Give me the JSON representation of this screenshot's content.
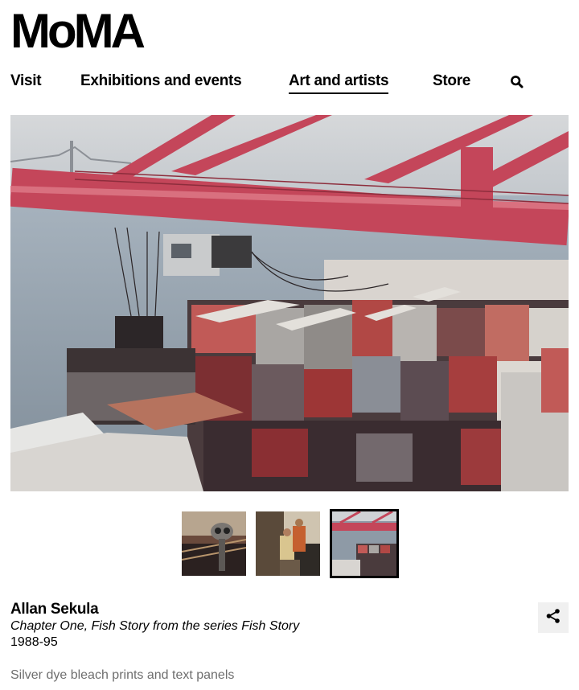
{
  "header": {
    "logo": "MoMA",
    "nav": [
      {
        "label": "Visit",
        "active": false
      },
      {
        "label": "Exhibitions and events",
        "active": false
      },
      {
        "label": "Art and artists",
        "active": true
      },
      {
        "label": "Store",
        "active": false
      }
    ],
    "search_icon": "search-icon"
  },
  "artwork": {
    "hero_image": "photo of cargo container ship with crane",
    "thumbnails": [
      {
        "subject": "coin-operated binoculars",
        "selected": false
      },
      {
        "subject": "workers on ship deck",
        "selected": false
      },
      {
        "subject": "container ship and crane",
        "selected": true
      }
    ],
    "artist": "Allan Sekula",
    "title": "Chapter One, Fish Story from the series Fish Story",
    "date": "1988-95",
    "medium": "Silver dye bleach prints and text panels",
    "share_icon": "share-icon"
  },
  "colors": {
    "crane": "#c4465a",
    "water": "#9aa9b6",
    "container_red": "#9c3a3c",
    "medium_text": "#6e6e6e",
    "share_bg": "#f0f0f0"
  }
}
